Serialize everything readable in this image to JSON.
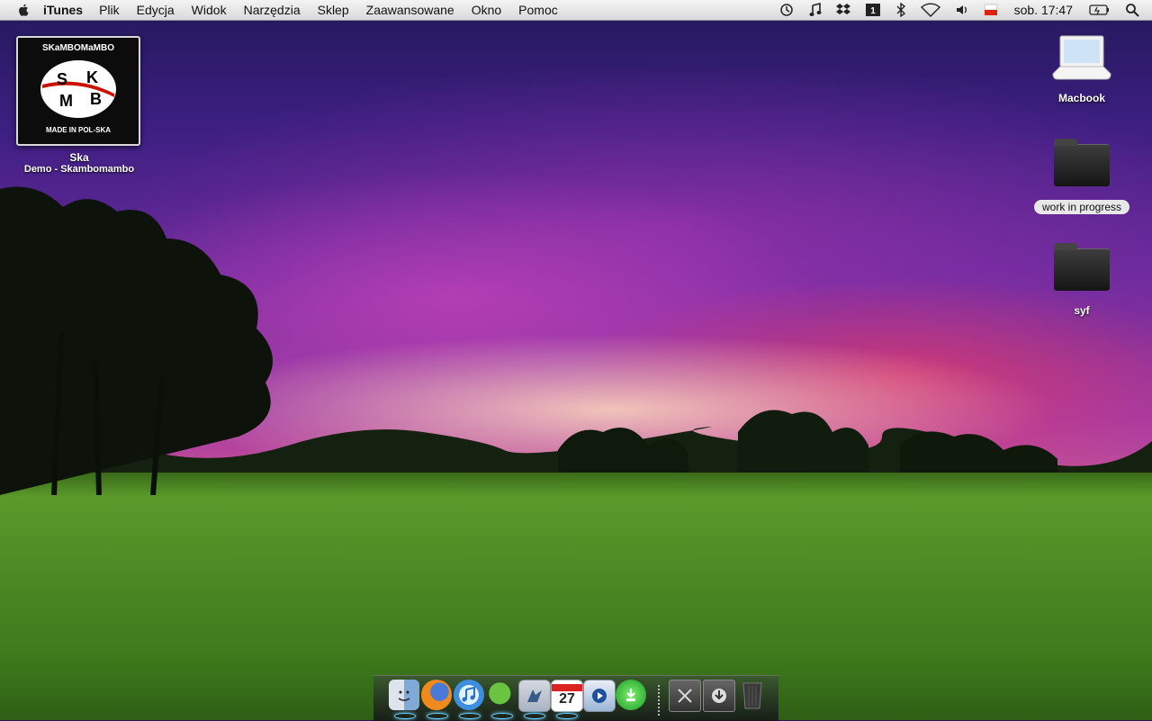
{
  "menubar": {
    "app_name": "iTunes",
    "menus": [
      "Plik",
      "Edycja",
      "Widok",
      "Narzędzia",
      "Sklep",
      "Zaawansowane",
      "Okno",
      "Pomoc"
    ],
    "status_icons": [
      "time-machine-icon",
      "itunes-note-icon",
      "dropbox-icon",
      "one-password-icon",
      "bluetooth-icon",
      "wifi-icon",
      "volume-icon",
      "flag-pl-icon",
      "clock-text",
      "battery-icon",
      "spotlight-icon"
    ],
    "clock": "sob. 17:47"
  },
  "desktop": {
    "album": {
      "cover_text": "SKaMBOMaMBO",
      "letters": [
        "S",
        "K",
        "M",
        "B"
      ],
      "banner": "MADE IN POL-SKA",
      "title": "Ska",
      "subtitle": "Demo - Skambomambo"
    },
    "icons": [
      {
        "label": "Macbook",
        "type": "laptop"
      },
      {
        "label": "work in progress",
        "type": "folder",
        "selected": true
      },
      {
        "label": "syf",
        "type": "folder"
      }
    ]
  },
  "dock": {
    "apps": [
      {
        "name": "finder-icon",
        "running": true
      },
      {
        "name": "firefox-icon",
        "running": true
      },
      {
        "name": "itunes-icon",
        "running": true
      },
      {
        "name": "adium-icon",
        "running": true
      },
      {
        "name": "mail-icon",
        "running": true
      },
      {
        "name": "ical-icon",
        "running": true,
        "date": "27"
      },
      {
        "name": "quicktime-icon",
        "running": false
      },
      {
        "name": "download-app-icon",
        "running": false
      }
    ],
    "right": [
      "close-stack-icon",
      "downloads-stack-icon",
      "trash-icon"
    ]
  },
  "colors": {
    "menubar": "#e6e6e6",
    "sky_top": "#23195a",
    "sky_glow": "#d2588f",
    "grass": "#4d8a24"
  }
}
